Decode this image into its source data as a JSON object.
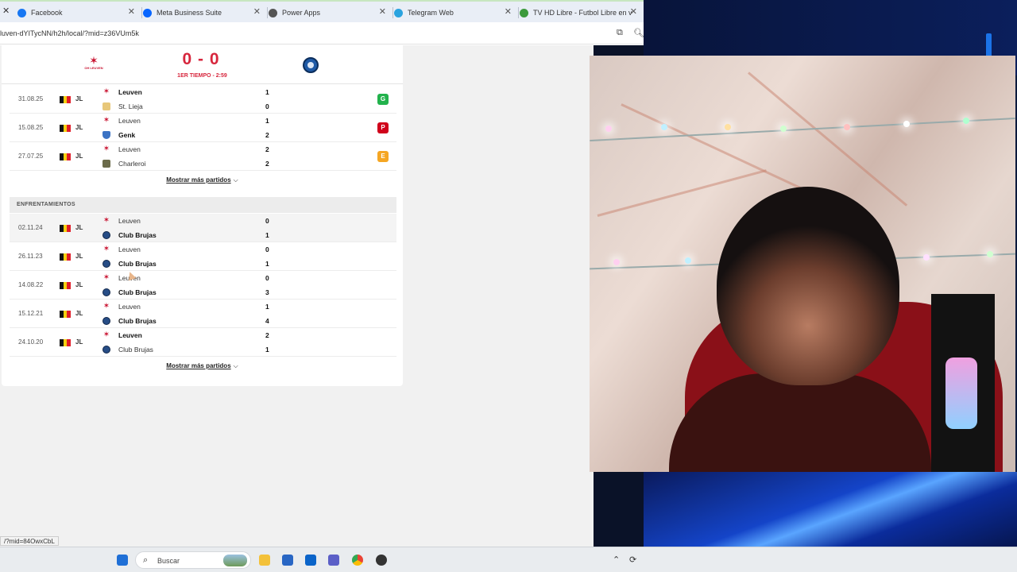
{
  "browser": {
    "tabs": [
      {
        "title": "Facebook",
        "icon": "facebook-icon",
        "color": "#1877f2"
      },
      {
        "title": "Meta Business Suite",
        "icon": "meta-icon",
        "color": "#0866ff"
      },
      {
        "title": "Power Apps",
        "icon": "globe-icon",
        "color": "#555555"
      },
      {
        "title": "Telegram Web",
        "icon": "telegram-icon",
        "color": "#2aa3df"
      },
      {
        "title": "TV HD Libre - Futbol Libre en v",
        "icon": "tv-icon",
        "color": "#3c9a3c"
      }
    ],
    "url": "luven-dYITycNN/h2h/local/?mid=z36VUm5k",
    "status_url": "/?mid=84OwxCbL"
  },
  "match": {
    "score": "0 - 0",
    "period": "1ER TIEMPO - 2:59",
    "home_logo_caption": "OH LEUVEN"
  },
  "recent_matches": [
    {
      "date": "31.08.25",
      "competition": "JL",
      "home": "Leuven",
      "home_score": "1",
      "away": "St. Lieja",
      "away_score": "0",
      "home_bold": true,
      "away_bold": false,
      "home_logo": "leu",
      "away_logo": "stl",
      "result": "G",
      "result_color": "#22b24c"
    },
    {
      "date": "15.08.25",
      "competition": "JL",
      "home": "Leuven",
      "home_score": "1",
      "away": "Genk",
      "away_score": "2",
      "home_bold": false,
      "away_bold": true,
      "home_logo": "leu",
      "away_logo": "genk",
      "result": "P",
      "result_color": "#d0021b"
    },
    {
      "date": "27.07.25",
      "competition": "JL",
      "home": "Leuven",
      "home_score": "2",
      "away": "Charleroi",
      "away_score": "2",
      "home_bold": false,
      "away_bold": false,
      "home_logo": "leu",
      "away_logo": "char",
      "result": "E",
      "result_color": "#f5a623"
    }
  ],
  "show_more_label": "Mostrar más partidos",
  "h2h_header": "ENFRENTAMIENTOS",
  "h2h_matches": [
    {
      "date": "02.11.24",
      "competition": "JL",
      "home": "Leuven",
      "home_score": "0",
      "away": "Club Brujas",
      "away_score": "1",
      "home_bold": false,
      "away_bold": true,
      "highlighted": true
    },
    {
      "date": "26.11.23",
      "competition": "JL",
      "home": "Leuven",
      "home_score": "0",
      "away": "Club Brujas",
      "away_score": "1",
      "home_bold": false,
      "away_bold": true,
      "highlighted": false
    },
    {
      "date": "14.08.22",
      "competition": "JL",
      "home": "Leuven",
      "home_score": "0",
      "away": "Club Brujas",
      "away_score": "3",
      "home_bold": false,
      "away_bold": true,
      "highlighted": false
    },
    {
      "date": "15.12.21",
      "competition": "JL",
      "home": "Leuven",
      "home_score": "1",
      "away": "Club Brujas",
      "away_score": "4",
      "home_bold": false,
      "away_bold": true,
      "highlighted": false
    },
    {
      "date": "24.10.20",
      "competition": "JL",
      "home": "Leuven",
      "home_score": "2",
      "away": "Club Brujas",
      "away_score": "1",
      "home_bold": true,
      "away_bold": false,
      "highlighted": false
    }
  ],
  "taskbar": {
    "search_placeholder": "Buscar"
  }
}
